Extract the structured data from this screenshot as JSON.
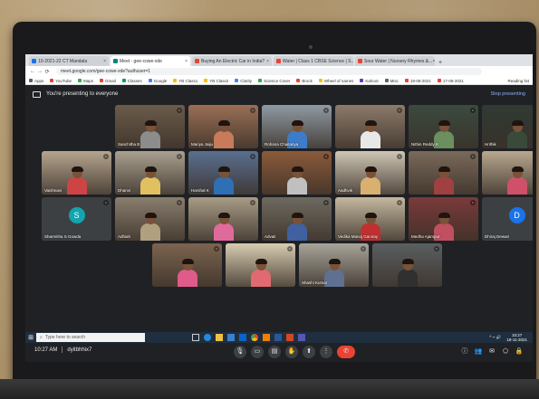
{
  "browser": {
    "tabs": [
      {
        "label": "10-2021-22 CT Mandala",
        "fav_color": "#1a73e8",
        "active": false
      },
      {
        "label": "Meet - gee-cowe-xde",
        "fav_color": "#00897b",
        "active": true
      },
      {
        "label": "Buying An Electric Car in India?",
        "fav_color": "#ea4335",
        "active": false
      },
      {
        "label": "Water | Class 1 CBSE Science | S...",
        "fav_color": "#ea4335",
        "active": false
      },
      {
        "label": "Sour Water | Nursery Rhymes &...",
        "fav_color": "#ea4335",
        "active": false
      }
    ],
    "new_tab": "+",
    "back": "←",
    "forward": "→",
    "reload": "⟳",
    "url": "meet.google.com/gee-cowe-xde?authuser=1",
    "bookmarks": [
      {
        "label": "Apps",
        "color": "#5f6368"
      },
      {
        "label": "YouTube",
        "color": "#ea4335"
      },
      {
        "label": "Maps",
        "color": "#34a853"
      },
      {
        "label": "Gmail",
        "color": "#ea4335"
      },
      {
        "label": "Classes",
        "color": "#0f9d58"
      },
      {
        "label": "Google",
        "color": "#4285f4"
      },
      {
        "label": "YB Class1",
        "color": "#fbbc04"
      },
      {
        "label": "YB Class2",
        "color": "#fbbc04"
      },
      {
        "label": "Clarity",
        "color": "#4285f4"
      },
      {
        "label": "Science Cover",
        "color": "#34a853"
      },
      {
        "label": "Brock",
        "color": "#ea4335"
      },
      {
        "label": "Wheel of names",
        "color": "#fbbc04"
      },
      {
        "label": "Kahoot",
        "color": "#673ab7"
      },
      {
        "label": "Misc",
        "color": "#5f6368"
      },
      {
        "label": "19-08-2021",
        "color": "#ea4335"
      },
      {
        "label": "17-08-2021",
        "color": "#ea4335"
      }
    ],
    "reading_list": "Reading list"
  },
  "meet": {
    "presenting_text": "You're presenting to everyone",
    "stop_presenting": "Stop presenting",
    "participants": [
      {
        "name": "",
        "type": "blank"
      },
      {
        "name": "Sanchitha B",
        "type": "video",
        "bg": "#6b5b4a",
        "shirt": "#8c8c8c"
      },
      {
        "name": "Mariya Jaiju",
        "type": "video",
        "bg": "#9a6f55",
        "shirt": "#c77b5a"
      },
      {
        "name": "Rohana Chaitanya",
        "type": "video",
        "bg": "#8f9aa3",
        "shirt": "#3d7cc9"
      },
      {
        "name": "",
        "type": "video",
        "bg": "#8d7b6b",
        "shirt": "#e8e8e8"
      },
      {
        "name": "Nithin Reddy K",
        "type": "video",
        "bg": "#3b4a3f",
        "shirt": "#6b8f5e"
      },
      {
        "name": "Hrithik",
        "type": "video",
        "bg": "#2f3a33",
        "shirt": "#3a4a3a"
      },
      {
        "name": "Vaishnavi",
        "type": "video",
        "bg": "#b5a58f",
        "shirt": "#c44"
      },
      {
        "name": "Dhanvi",
        "type": "video",
        "bg": "#a9a090",
        "shirt": "#e0c060"
      },
      {
        "name": "Harshal K",
        "type": "video",
        "bg": "#5a6f8f",
        "shirt": "#2f6fb3"
      },
      {
        "name": "",
        "type": "video",
        "bg": "#8b5a3a",
        "shirt": "#c0c0c0"
      },
      {
        "name": "Aadhvik",
        "type": "video",
        "bg": "#cfc6b5",
        "shirt": "#d9b070"
      },
      {
        "name": "",
        "type": "video",
        "bg": "#7a6a5a",
        "shirt": "#a04040"
      },
      {
        "name": "",
        "type": "video",
        "bg": "#b8a890",
        "shirt": "#d0506a"
      },
      {
        "name": "Sharmitha S Gowda",
        "type": "avatar",
        "initial": "S",
        "color": "#12a4af"
      },
      {
        "name": "Adhiah",
        "type": "video",
        "bg": "#8a7e6e",
        "shirt": "#b0a080"
      },
      {
        "name": "",
        "type": "video",
        "bg": "#a89c86",
        "shirt": "#e06a9a"
      },
      {
        "name": "Advait",
        "type": "video",
        "bg": "#6e6a60",
        "shirt": "#4060a0"
      },
      {
        "name": "Vedika Manoj Ganiray",
        "type": "video",
        "bg": "#c4b8a0",
        "shirt": "#c03030"
      },
      {
        "name": "Medha Ajampur",
        "type": "video",
        "bg": "#7a3a3a",
        "shirt": "#c05060"
      },
      {
        "name": "Dhiraj Dewati",
        "type": "avatar",
        "initial": "D",
        "color": "#1a73e8"
      },
      {
        "name": "",
        "type": "video",
        "bg": "#7c6450",
        "shirt": "#e05a8a"
      },
      {
        "name": "",
        "type": "video",
        "bg": "#d8ccb0",
        "shirt": "#e06a70"
      },
      {
        "name": "Shashi Kumar",
        "type": "video",
        "bg": "#a7a49a",
        "shirt": "#607090"
      },
      {
        "name": "",
        "type": "video",
        "bg": "#5a5f60",
        "shirt": "#303030"
      }
    ],
    "time": "10:27 AM",
    "meeting_code": "dyitbhhix7",
    "controls": [
      {
        "name": "mic-button",
        "glyph": "🎙"
      },
      {
        "name": "camera-button",
        "glyph": "▭"
      },
      {
        "name": "captions-button",
        "glyph": "▤"
      },
      {
        "name": "raise-hand-button",
        "glyph": "✋"
      },
      {
        "name": "present-button",
        "glyph": "⬆"
      },
      {
        "name": "more-options-button",
        "glyph": "⋮"
      },
      {
        "name": "leave-call-button",
        "glyph": "✆"
      }
    ],
    "right_icons": [
      {
        "name": "info-icon",
        "glyph": "ⓘ"
      },
      {
        "name": "people-icon",
        "glyph": "👥"
      },
      {
        "name": "chat-icon",
        "glyph": "✉"
      },
      {
        "name": "activities-icon",
        "glyph": "⬠"
      },
      {
        "name": "lock-icon",
        "glyph": "🔒"
      }
    ]
  },
  "taskbar": {
    "search_placeholder": "Type here to search",
    "clock_time": "10:27",
    "clock_date": "18-11-2021"
  }
}
